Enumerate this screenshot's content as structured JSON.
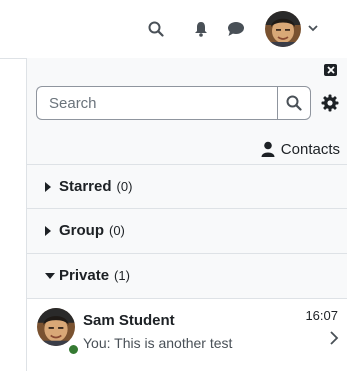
{
  "navbar": {
    "icons": [
      "search-icon",
      "bell-icon",
      "chat-icon",
      "avatar",
      "chevron-down-icon"
    ]
  },
  "drawer": {
    "search": {
      "placeholder": "Search",
      "value": ""
    },
    "contacts_label": "Contacts",
    "sections": [
      {
        "title": "Starred",
        "count": "(0)",
        "expanded": false
      },
      {
        "title": "Group",
        "count": "(0)",
        "expanded": false
      },
      {
        "title": "Private",
        "count": "(1)",
        "expanded": true
      }
    ],
    "conversation": {
      "name": "Sam Student",
      "preview": "You: This is another test",
      "time": "16:07",
      "online": true
    }
  },
  "colors": {
    "online": "#357a32",
    "text": "#1d2125",
    "drawer_bg": "#f8f9fa",
    "border": "#dee2e6"
  }
}
